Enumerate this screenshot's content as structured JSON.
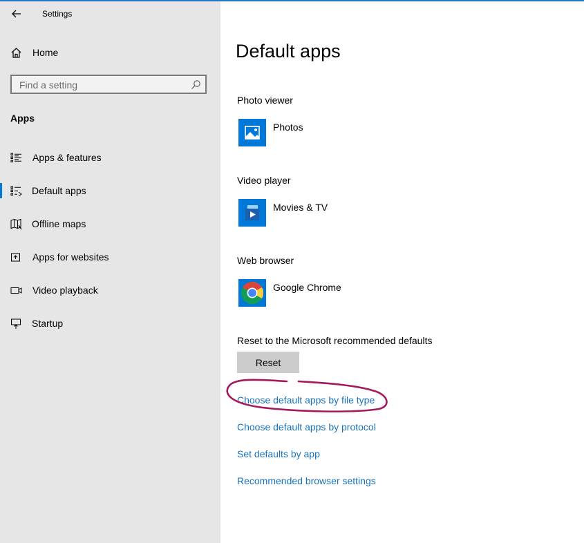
{
  "window": {
    "title": "Settings"
  },
  "sidebar": {
    "home_label": "Home",
    "search_placeholder": "Find a setting",
    "section_title": "Apps",
    "items": [
      {
        "label": "Apps & features",
        "icon": "list-icon",
        "selected": false
      },
      {
        "label": "Default apps",
        "icon": "default-apps-icon",
        "selected": true
      },
      {
        "label": "Offline maps",
        "icon": "map-icon",
        "selected": false
      },
      {
        "label": "Apps for websites",
        "icon": "open-in-new-icon",
        "selected": false
      },
      {
        "label": "Video playback",
        "icon": "video-camera-icon",
        "selected": false
      },
      {
        "label": "Startup",
        "icon": "startup-icon",
        "selected": false
      }
    ]
  },
  "main": {
    "title": "Default apps",
    "groups": [
      {
        "label": "Photo viewer",
        "app": "Photos",
        "icon": "photos-app-icon"
      },
      {
        "label": "Video player",
        "app": "Movies & TV",
        "icon": "movies-tv-app-icon"
      },
      {
        "label": "Web browser",
        "app": "Google Chrome",
        "icon": "chrome-app-icon"
      }
    ],
    "reset_label": "Reset to the Microsoft recommended defaults",
    "reset_button": "Reset",
    "links": [
      "Choose default apps by file type",
      "Choose default apps by protocol",
      "Set defaults by app",
      "Recommended browser settings"
    ]
  },
  "colors": {
    "accent": "#0078d7",
    "link": "#1a73b8",
    "sidebar_bg": "#e6e6e6",
    "annotation": "#a3195b"
  }
}
